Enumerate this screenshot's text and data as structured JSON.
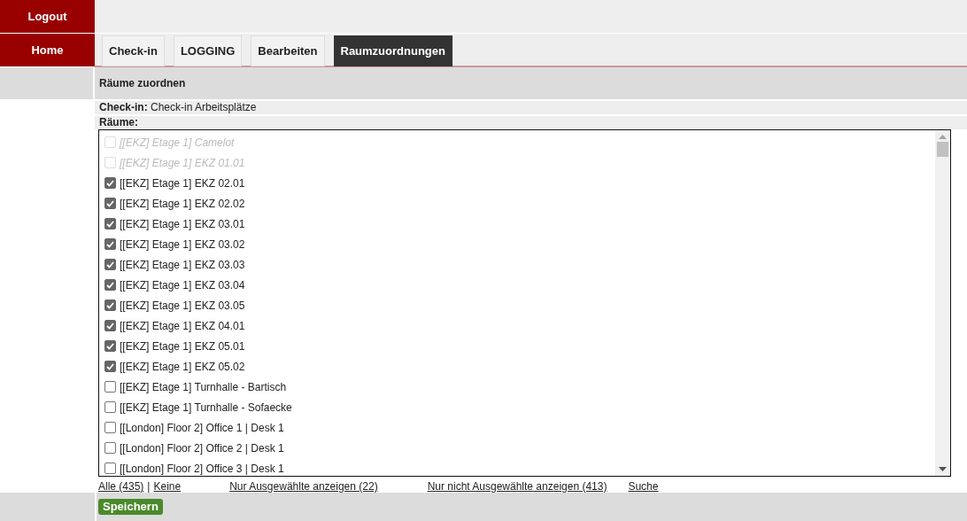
{
  "sidebar": {
    "items": [
      {
        "label": "Logout"
      },
      {
        "label": "Home"
      }
    ]
  },
  "tabs": [
    {
      "label": "Check-in",
      "selected": false
    },
    {
      "label": "LOGGING",
      "selected": false
    },
    {
      "label": "Bearbeiten",
      "selected": false
    },
    {
      "label": "Raumzuordnungen",
      "selected": true
    }
  ],
  "section_title": "Räume zuordnen",
  "checkin": {
    "label": "Check-in:",
    "value": "Check-in Arbeitsplätze"
  },
  "rooms_label": "Räume:",
  "rooms": [
    {
      "label": "[[EKZ] Etage 1] Camelot",
      "checked": false,
      "disabled": true
    },
    {
      "label": "[[EKZ] Etage 1] EKZ 01.01",
      "checked": false,
      "disabled": true
    },
    {
      "label": "[[EKZ] Etage 1] EKZ 02.01",
      "checked": true,
      "disabled": false
    },
    {
      "label": "[[EKZ] Etage 1] EKZ 02.02",
      "checked": true,
      "disabled": false
    },
    {
      "label": "[[EKZ] Etage 1] EKZ 03.01",
      "checked": true,
      "disabled": false
    },
    {
      "label": "[[EKZ] Etage 1] EKZ 03.02",
      "checked": true,
      "disabled": false
    },
    {
      "label": "[[EKZ] Etage 1] EKZ 03.03",
      "checked": true,
      "disabled": false
    },
    {
      "label": "[[EKZ] Etage 1] EKZ 03.04",
      "checked": true,
      "disabled": false
    },
    {
      "label": "[[EKZ] Etage 1] EKZ 03.05",
      "checked": true,
      "disabled": false
    },
    {
      "label": "[[EKZ] Etage 1] EKZ 04.01",
      "checked": true,
      "disabled": false
    },
    {
      "label": "[[EKZ] Etage 1] EKZ 05.01",
      "checked": true,
      "disabled": false
    },
    {
      "label": "[[EKZ] Etage 1] EKZ 05.02",
      "checked": true,
      "disabled": false
    },
    {
      "label": "[[EKZ] Etage 1] Turnhalle - Bartisch",
      "checked": false,
      "disabled": false
    },
    {
      "label": "[[EKZ] Etage 1] Turnhalle - Sofaecke",
      "checked": false,
      "disabled": false
    },
    {
      "label": "[[London] Floor 2] Office 1 | Desk 1",
      "checked": false,
      "disabled": false
    },
    {
      "label": "[[London] Floor 2] Office 2 | Desk 1",
      "checked": false,
      "disabled": false
    },
    {
      "label": "[[London] Floor 2] Office 3 | Desk 1",
      "checked": false,
      "disabled": false
    }
  ],
  "footer_links": [
    {
      "label": "Alle (435)",
      "kind": "link"
    },
    {
      "label": "|",
      "kind": "separator"
    },
    {
      "label": "Keine",
      "kind": "link"
    },
    {
      "label": "Nur Ausgewählte anzeigen (22)",
      "kind": "link"
    },
    {
      "label": "Nur nicht Ausgewählte anzeigen (413)",
      "kind": "link"
    },
    {
      "label": "Suche",
      "kind": "link"
    }
  ],
  "save_button": "Speichern"
}
